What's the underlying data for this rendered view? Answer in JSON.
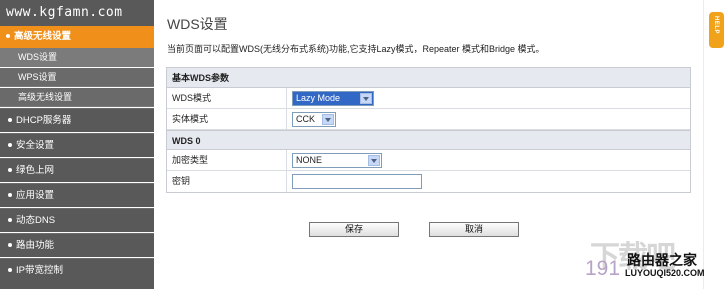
{
  "watermark_top": "www.kgfamn.com",
  "sidebar": {
    "active_section": "高级无线设置",
    "sub_items": [
      {
        "label": "WDS设置",
        "current": true
      },
      {
        "label": "WPS设置",
        "current": false
      },
      {
        "label": "高级无线设置",
        "current": false
      }
    ],
    "main_items": [
      {
        "label": "DHCP服务器"
      },
      {
        "label": "安全设置"
      },
      {
        "label": "绿色上网"
      },
      {
        "label": "应用设置"
      },
      {
        "label": "动态DNS"
      },
      {
        "label": "路由功能"
      },
      {
        "label": "IP带宽控制"
      }
    ]
  },
  "page": {
    "title": "WDS设置",
    "description": "当前页面可以配置WDS(无线分布式系统)功能,它支持Lazy模式，Repeater 模式和Bridge 模式。"
  },
  "basic_section": {
    "heading": "基本WDS参数",
    "mode_label": "WDS模式",
    "mode_value": "Lazy Mode",
    "phy_label": "实体模式",
    "phy_value": "CCK"
  },
  "wds0_section": {
    "heading": "WDS 0",
    "enc_label": "加密类型",
    "enc_value": "NONE",
    "key_label": "密钥",
    "key_value": ""
  },
  "buttons": {
    "save": "保存",
    "cancel": "取消"
  },
  "help": "HELP",
  "watermarks": {
    "big": "下载吧",
    "num": "191",
    "site_cn": "路由器之家",
    "site_url": "LUYOUQI520.COM"
  },
  "colors": {
    "accent": "#f08f19",
    "sidebar_bg": "#595959",
    "header_bg": "#e6eaf0",
    "select_highlight": "#3168c6"
  }
}
